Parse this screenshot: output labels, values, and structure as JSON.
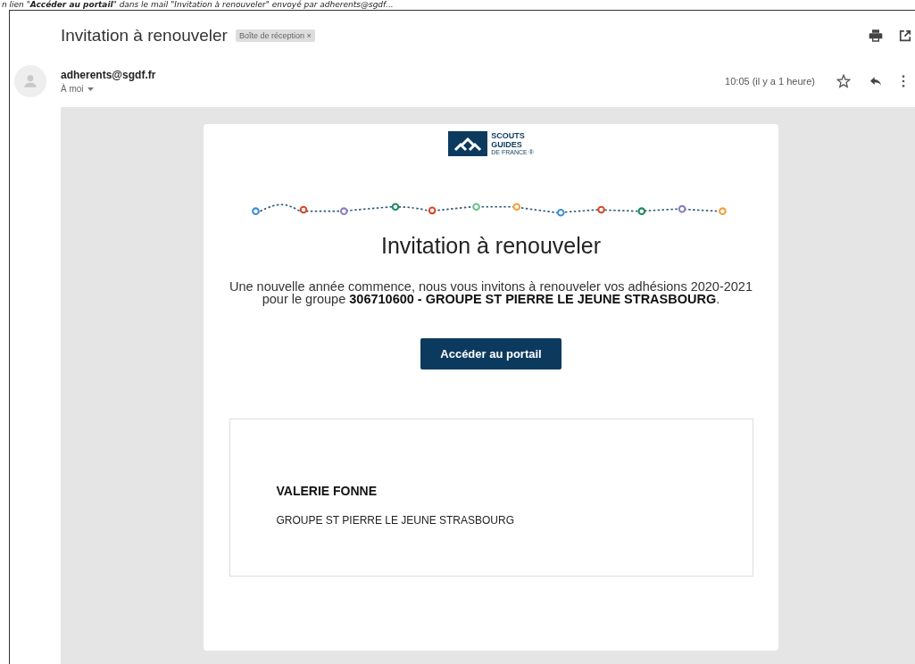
{
  "caption": "n lien \"**Accéder au portail**\" dans le mail \"Invitation à renouveler\" envoyé par adherents@sgdf...",
  "message": {
    "subject": "Invitation à renouveler",
    "label": "Boîte de réception",
    "label_close": "×",
    "sender": "adherents@sgdf.fr",
    "recipient": "À moi",
    "time": "10:05 (il y a 1 heure)",
    "starred": false
  },
  "email": {
    "logo": [
      "SCOUTS",
      "GUIDES",
      "DE FRANCE ®"
    ],
    "heading": "Invitation à renouveler",
    "intro": "Une nouvelle année commence, nous vous invitons à renouveler vos adhésions 2020-2021 pour le groupe **306710600 - GROUPE ST PIERRE LE JEUNE STRASBOURG**.",
    "button": "Accéder au portail",
    "person": {
      "name": "VALERIE FONNE",
      "group": "GROUPE ST PIERRE LE JEUNE STRASBOURG"
    }
  }
}
